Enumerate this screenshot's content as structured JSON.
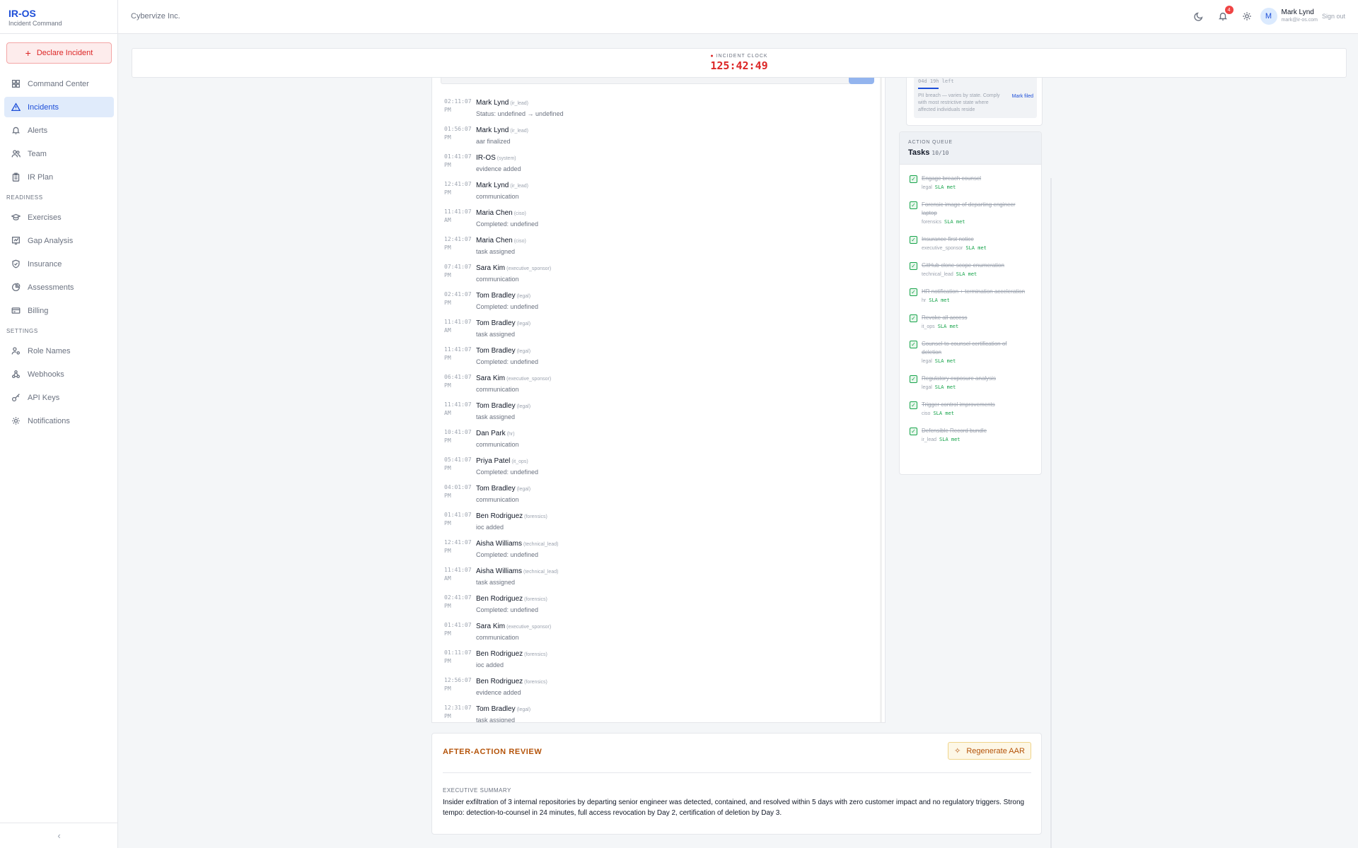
{
  "brand": {
    "title": "IR-OS",
    "subtitle": "Incident Command"
  },
  "declare_button": {
    "label": "Declare Incident"
  },
  "nav": {
    "primary": [
      {
        "label": "Command Center",
        "icon": "grid-icon"
      },
      {
        "label": "Incidents",
        "icon": "triangle-alert-icon",
        "active": true
      },
      {
        "label": "Alerts",
        "icon": "bell-icon"
      },
      {
        "label": "Team",
        "icon": "users-icon"
      },
      {
        "label": "IR Plan",
        "icon": "clipboard-icon"
      }
    ],
    "readiness_heading": "READINESS",
    "readiness": [
      {
        "label": "Exercises",
        "icon": "graduation-cap-icon"
      },
      {
        "label": "Gap Analysis",
        "icon": "chart-icon"
      },
      {
        "label": "Insurance",
        "icon": "shield-check-icon"
      },
      {
        "label": "Assessments",
        "icon": "pie-icon"
      },
      {
        "label": "Billing",
        "icon": "card-icon"
      }
    ],
    "settings_heading": "SETTINGS",
    "settings": [
      {
        "label": "Role Names",
        "icon": "user-cog-icon"
      },
      {
        "label": "Webhooks",
        "icon": "webhook-icon"
      },
      {
        "label": "API Keys",
        "icon": "key-icon"
      },
      {
        "label": "Notifications",
        "icon": "gear-icon"
      }
    ]
  },
  "topbar": {
    "org": "Cybervize Inc.",
    "notification_count": "4",
    "user_initial": "M",
    "user_name": "Mark Lynd",
    "user_email": "mark@ir-os.com",
    "signout": "Sign out"
  },
  "clock": {
    "label": "INCIDENT CLOCK",
    "hours": "125",
    "minutes": "42",
    "seconds": "49"
  },
  "timeline": [
    {
      "time": "02:11:07",
      "ampm": "PM",
      "actor": "Mark Lynd",
      "role": "(ir_lead)",
      "desc": "Status: undefined → undefined"
    },
    {
      "time": "01:56:07",
      "ampm": "PM",
      "actor": "Mark Lynd",
      "role": "(ir_lead)",
      "desc": "aar finalized"
    },
    {
      "time": "01:41:07",
      "ampm": "PM",
      "actor": "IR-OS",
      "role": "(system)",
      "desc": "evidence added"
    },
    {
      "time": "12:41:07",
      "ampm": "PM",
      "actor": "Mark Lynd",
      "role": "(ir_lead)",
      "desc": "communication"
    },
    {
      "time": "11:41:07",
      "ampm": "AM",
      "actor": "Maria Chen",
      "role": "(ciso)",
      "desc": "Completed: undefined"
    },
    {
      "time": "12:41:07",
      "ampm": "PM",
      "actor": "Maria Chen",
      "role": "(ciso)",
      "desc": "task assigned"
    },
    {
      "time": "07:41:07",
      "ampm": "PM",
      "actor": "Sara Kim",
      "role": "(executive_sponsor)",
      "desc": "communication"
    },
    {
      "time": "02:41:07",
      "ampm": "PM",
      "actor": "Tom Bradley",
      "role": "(legal)",
      "desc": "Completed: undefined"
    },
    {
      "time": "11:41:07",
      "ampm": "AM",
      "actor": "Tom Bradley",
      "role": "(legal)",
      "desc": "task assigned"
    },
    {
      "time": "11:41:07",
      "ampm": "PM",
      "actor": "Tom Bradley",
      "role": "(legal)",
      "desc": "Completed: undefined"
    },
    {
      "time": "06:41:07",
      "ampm": "PM",
      "actor": "Sara Kim",
      "role": "(executive_sponsor)",
      "desc": "communication"
    },
    {
      "time": "11:41:07",
      "ampm": "AM",
      "actor": "Tom Bradley",
      "role": "(legal)",
      "desc": "task assigned"
    },
    {
      "time": "10:41:07",
      "ampm": "PM",
      "actor": "Dan Park",
      "role": "(hr)",
      "desc": "communication"
    },
    {
      "time": "05:41:07",
      "ampm": "PM",
      "actor": "Priya Patel",
      "role": "(it_ops)",
      "desc": "Completed: undefined"
    },
    {
      "time": "04:01:07",
      "ampm": "PM",
      "actor": "Tom Bradley",
      "role": "(legal)",
      "desc": "communication"
    },
    {
      "time": "01:41:07",
      "ampm": "PM",
      "actor": "Ben Rodriguez",
      "role": "(forensics)",
      "desc": "ioc added"
    },
    {
      "time": "12:41:07",
      "ampm": "PM",
      "actor": "Aisha Williams",
      "role": "(technical_lead)",
      "desc": "Completed: undefined"
    },
    {
      "time": "11:41:07",
      "ampm": "AM",
      "actor": "Aisha Williams",
      "role": "(technical_lead)",
      "desc": "task assigned"
    },
    {
      "time": "02:41:07",
      "ampm": "PM",
      "actor": "Ben Rodriguez",
      "role": "(forensics)",
      "desc": "Completed: undefined"
    },
    {
      "time": "01:41:07",
      "ampm": "PM",
      "actor": "Sara Kim",
      "role": "(executive_sponsor)",
      "desc": "communication"
    },
    {
      "time": "01:11:07",
      "ampm": "PM",
      "actor": "Ben Rodriguez",
      "role": "(forensics)",
      "desc": "ioc added"
    },
    {
      "time": "12:56:07",
      "ampm": "PM",
      "actor": "Ben Rodriguez",
      "role": "(forensics)",
      "desc": "evidence added"
    },
    {
      "time": "12:31:07",
      "ampm": "PM",
      "actor": "Tom Bradley",
      "role": "(legal)",
      "desc": "task assigned"
    }
  ],
  "pii_card": {
    "time_left": "04d 19h left",
    "progress": 0.18,
    "note": "PII breach — varies by state. Comply with most restrictive state where affected individuals reside",
    "action": "Mark filed"
  },
  "queue": {
    "kicker": "ACTION QUEUE",
    "title": "Tasks",
    "count": "10/10",
    "tasks": [
      {
        "title": "Engage breach counsel",
        "role": "legal",
        "sla": "SLA met"
      },
      {
        "title": "Forensic image of departing engineer laptop",
        "role": "forensics",
        "sla": "SLA met"
      },
      {
        "title": "Insurance first notice",
        "role": "executive_sponsor",
        "sla": "SLA met"
      },
      {
        "title": "GitHub clone-scope enumeration",
        "role": "technical_lead",
        "sla": "SLA met"
      },
      {
        "title": "HR notification + termination acceleration",
        "role": "hr",
        "sla": "SLA met"
      },
      {
        "title": "Revoke all access",
        "role": "it_ops",
        "sla": "SLA met"
      },
      {
        "title": "Counsel-to-counsel certification of deletion",
        "role": "legal",
        "sla": "SLA met"
      },
      {
        "title": "Regulatory exposure analysis",
        "role": "legal",
        "sla": "SLA met"
      },
      {
        "title": "Trigger control improvements",
        "role": "ciso",
        "sla": "SLA met"
      },
      {
        "title": "Defensible Record bundle",
        "role": "ir_lead",
        "sla": "SLA met"
      }
    ]
  },
  "aar": {
    "title": "AFTER-ACTION REVIEW",
    "button": "Regenerate AAR",
    "summary_heading": "EXECUTIVE SUMMARY",
    "summary": "Insider exfiltration of 3 internal repositories by departing senior engineer was detected, contained, and resolved within 5 days with zero customer impact and no regulatory triggers. Strong tempo: detection-to-counsel in 24 minutes, full access revocation by Day 2, certification of deletion by Day 3."
  },
  "colors": {
    "accent": "#1d4ed8",
    "danger": "#dc2626",
    "success": "#16a34a",
    "amber": "#b45309"
  }
}
